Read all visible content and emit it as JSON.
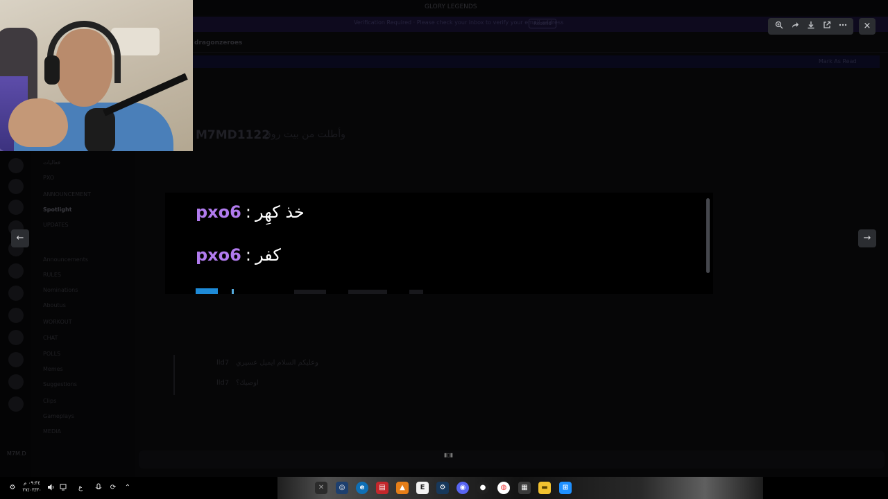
{
  "window": {
    "title": "GLORY LEGENDS"
  },
  "background": {
    "banner_text": "Verification Required · Please check your inbox to verify your email address",
    "banner_button": "Resend",
    "channel_name": "dragonzeroes",
    "channel_topic": "",
    "new_messages_right": "Mark As Read",
    "bg_message_name": "M7MD1122",
    "bg_message_text": "وأطلت من بيت روق",
    "embed_line1_name": "lld7",
    "embed_line1_text": "وعليكم السلام ايميل عسيري",
    "embed_line2_name": "lld7",
    "embed_line2_text": "اوصيك؟",
    "bg_user_name": "M7M.D",
    "sidebar_items": [
      "فعاليات",
      "PXO",
      "ANNOUNCEMENT",
      "Spotlight",
      "UPDATES",
      "Announcements",
      "RULES",
      "Nominations",
      "Aboutus",
      "WORKOUT",
      "CHAT",
      "POLLS",
      "Memes",
      "Suggestions",
      "Clips",
      "Gameplays",
      "MEDIA"
    ],
    "input_placeholder": ""
  },
  "viewer": {
    "toolbar": {
      "zoom": "zoom-in-icon",
      "forward": "share-icon",
      "download": "download-icon",
      "open": "open-external-icon",
      "more": "more-icon"
    },
    "close": "×",
    "prev": "←",
    "next": "→"
  },
  "image": {
    "lines": [
      {
        "name": "pxo6",
        "text": "خذ كهِر"
      },
      {
        "name": "pxo6",
        "text": "كفر"
      }
    ]
  },
  "taskbar": {
    "time": "٠٩:٣٤ م",
    "date": "٢٧/٠٣/٣٠",
    "lang": "ع",
    "apps": [
      "Xbox",
      "Copilot",
      "Edge",
      "WinRAR",
      "VLC",
      "Epic",
      "Steam",
      "Discord",
      "OBS",
      "Chrome",
      "Store",
      "Files",
      "Start"
    ]
  }
}
